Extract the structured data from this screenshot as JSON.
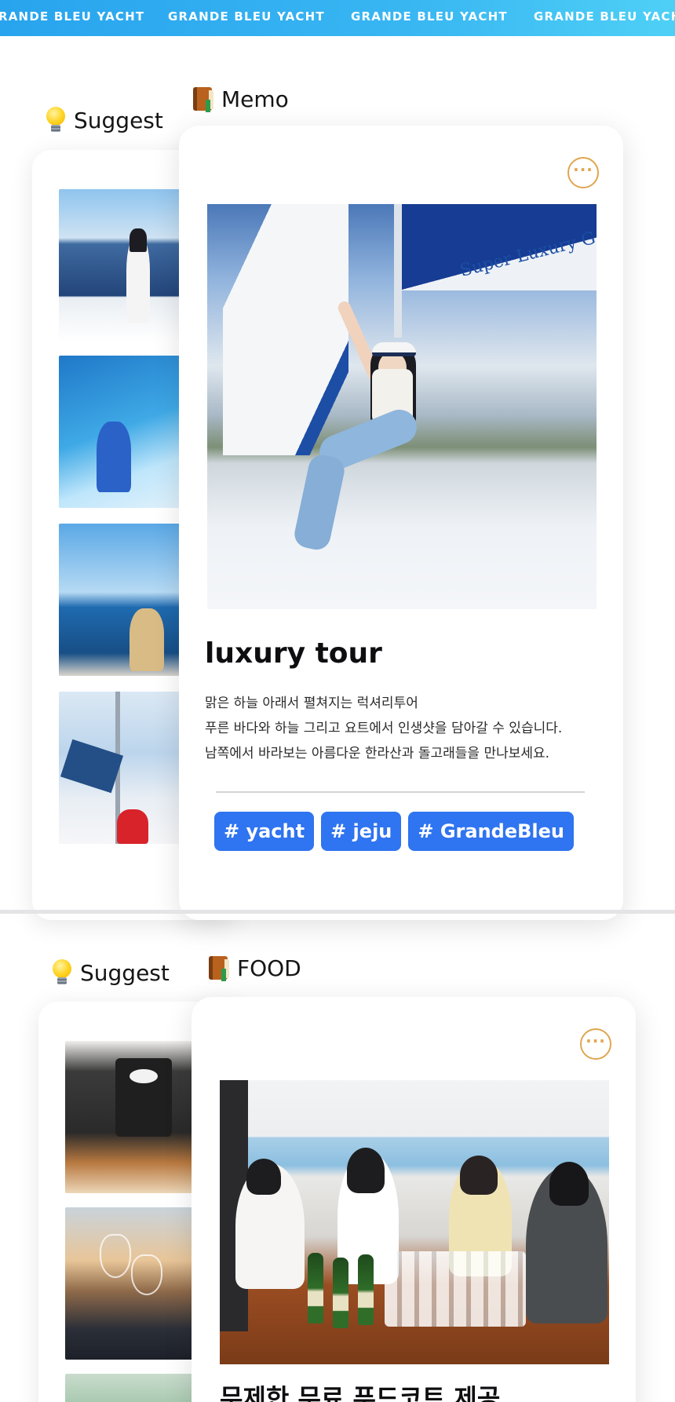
{
  "marquee": {
    "items": [
      "RANDE BLEU YACHT",
      "GRANDE BLEU YACHT",
      "GRANDE BLEU YACHT",
      "GRANDE BLEU YACH"
    ]
  },
  "sections": [
    {
      "suggest_label": "Suggest",
      "panel_label": "Memo",
      "more_label": "···",
      "photo_sail_text": "Super Luxury G",
      "title": "luxury tour",
      "description": [
        "맑은 하늘 아래서 펼쳐지는 럭셔리투어",
        "푸른 바다와 하늘 그리고 요트에서 인생샷을 담아갈 수 있습니다.",
        "남쪽에서 바라보는 아름다운 한라산과 돌고래들을 만나보세요."
      ],
      "tags": [
        "# yacht",
        "# jeju",
        "# GrandeBleu"
      ]
    },
    {
      "suggest_label": "Suggest",
      "panel_label": "FOOD",
      "more_label": "···",
      "title": "무제한 무료 푸드코트 제공"
    }
  ],
  "colors": {
    "accent": "#2f74f0",
    "marquee_start": "#28a4ee",
    "marquee_end": "#4ed0f6",
    "more_button": "#e0a650"
  },
  "icons": {
    "suggest": "light-bulb-icon",
    "panel": "book-icon",
    "more": "ellipsis-icon"
  }
}
